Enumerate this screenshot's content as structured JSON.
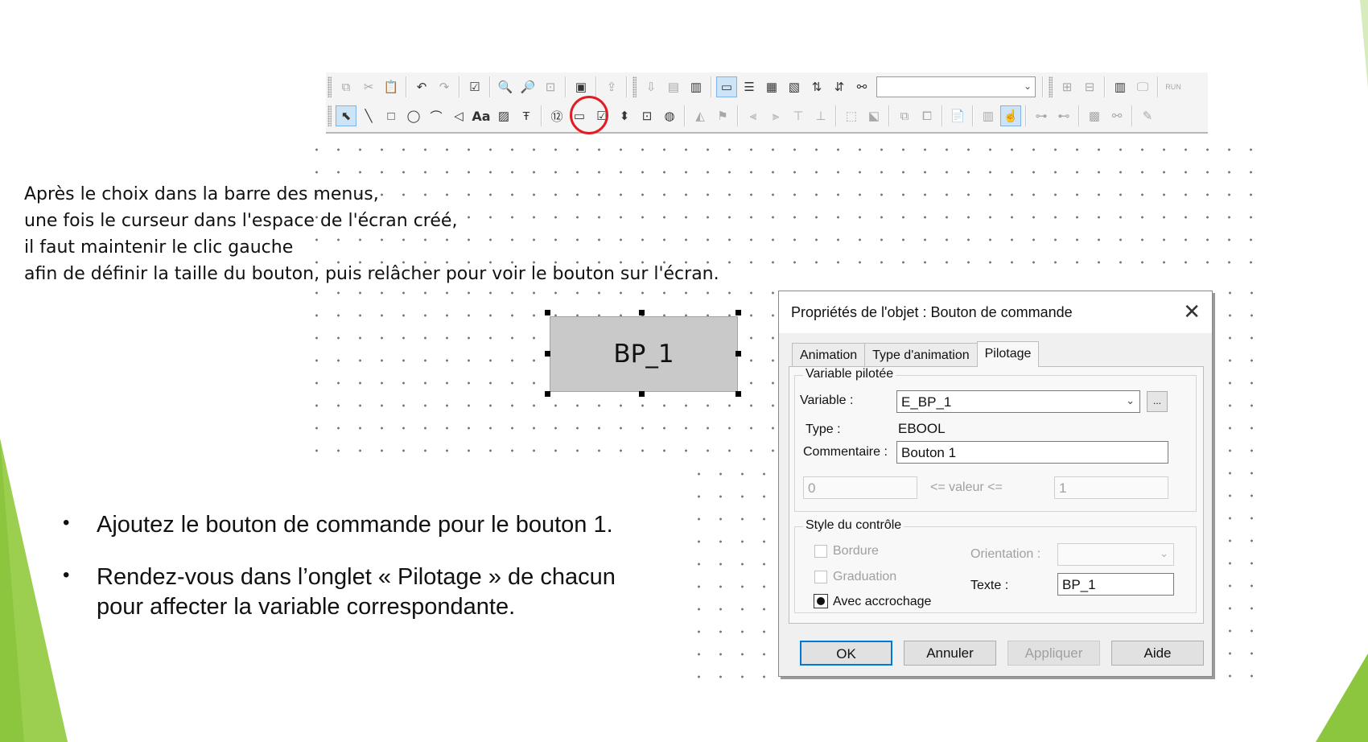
{
  "toolbar": {
    "combo_value": "",
    "run_label": "RUN",
    "text_tool_label": "Aa"
  },
  "instructions": [
    "Après le choix dans la barre des menus,",
    "une fois le curseur dans l'espace de l'écran créé,",
    "il faut maintenir le clic gauche",
    "afin de définir la taille du bouton, puis relâcher pour voir le bouton sur l'écran."
  ],
  "canvas_button": {
    "label": "BP_1"
  },
  "bullets": [
    {
      "dot": "•",
      "text": "Ajoutez le bouton de commande pour le bouton 1."
    },
    {
      "dot": "•",
      "text": "Rendez-vous dans l’onglet « Pilotage » de chacun",
      "text2": "pour affecter la variable correspondante."
    }
  ],
  "dialog": {
    "title": "Propriétés de l'objet : Bouton de commande",
    "close": "✕",
    "tabs": [
      "Animation",
      "Type d'animation",
      "Pilotage"
    ],
    "group1": {
      "label": "Variable pilotée",
      "variable_label": "Variable :",
      "variable_value": "E_BP_1",
      "ellipsis": "...",
      "type_label": "Type :",
      "type_value": "EBOOL",
      "comment_label": "Commentaire :",
      "comment_value": "Bouton 1",
      "min_value": "0",
      "range_label": "<= valeur <=",
      "max_value": "1"
    },
    "group2": {
      "label": "Style du contrôle",
      "border_label": "Bordure",
      "graduation_label": "Graduation",
      "latch_label": "Avec accrochage",
      "orientation_label": "Orientation :",
      "orientation_value": "",
      "text_label": "Texte :",
      "text_value": "BP_1"
    },
    "buttons": {
      "ok": "OK",
      "cancel": "Annuler",
      "apply": "Appliquer",
      "help": "Aide"
    }
  },
  "colors": {
    "accent_green": "#8cc63f",
    "highlight_circle": "#e31b23",
    "dialog_focus": "#0078d7"
  }
}
